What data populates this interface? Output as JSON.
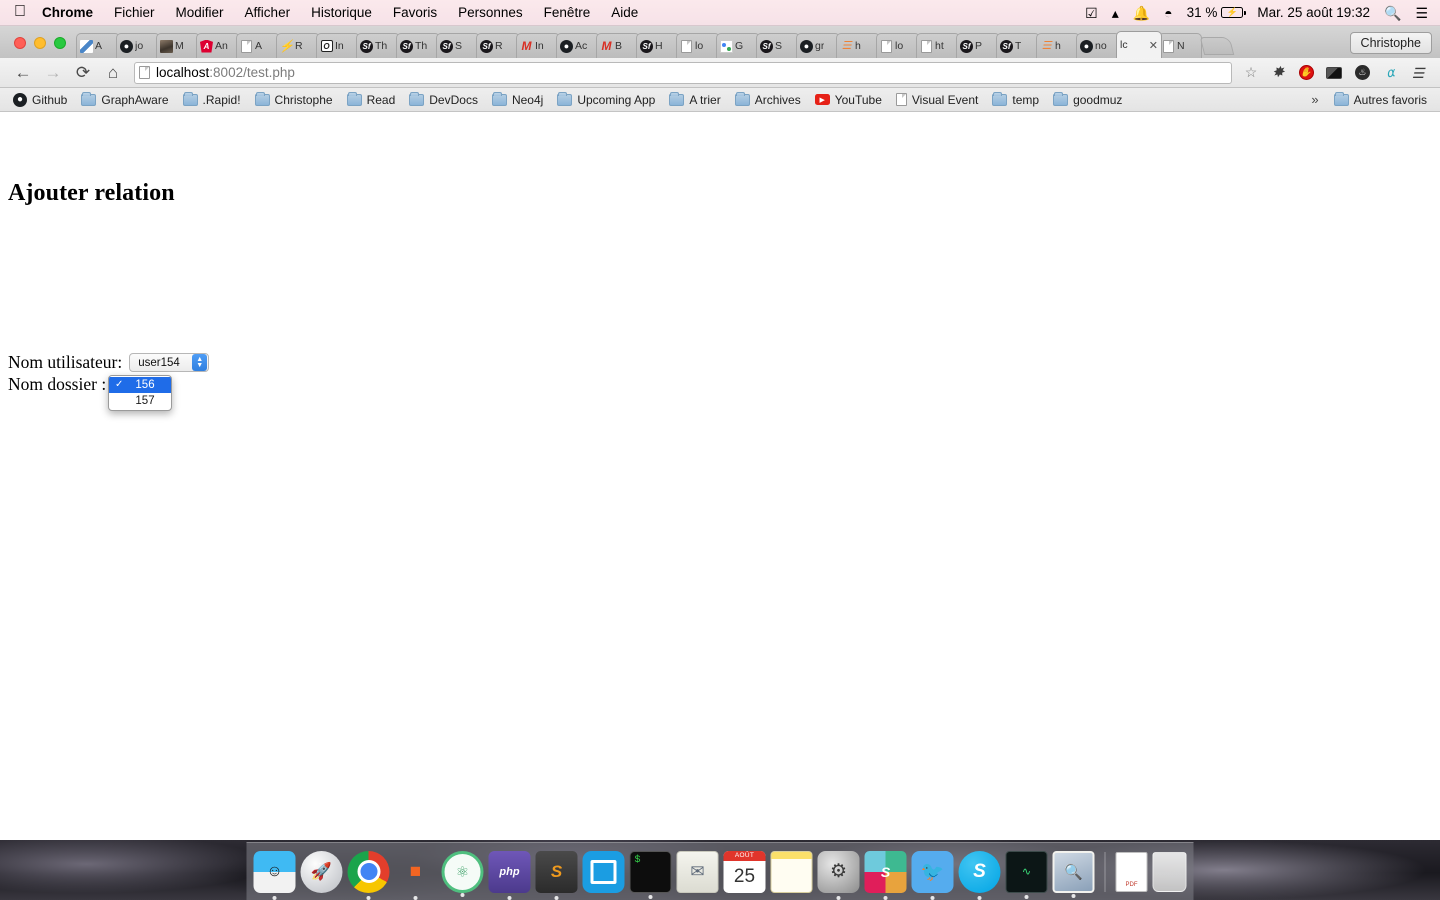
{
  "menubar": {
    "apple_icon": "apple-icon",
    "items": [
      {
        "label": "Chrome",
        "bold": true
      },
      {
        "label": "Fichier",
        "bold": false
      },
      {
        "label": "Modifier",
        "bold": false
      },
      {
        "label": "Afficher",
        "bold": false
      },
      {
        "label": "Historique",
        "bold": false
      },
      {
        "label": "Favoris",
        "bold": false
      },
      {
        "label": "Personnes",
        "bold": false
      },
      {
        "label": "Fenêtre",
        "bold": false
      },
      {
        "label": "Aide",
        "bold": false
      }
    ],
    "status": {
      "checkmark_icon": "checkmark-circle-icon",
      "drive_icon": "google-drive-icon",
      "bell_icon": "bell-icon",
      "wifi_icon": "wifi-icon",
      "battery_percent": "31 %",
      "battery_icon": "battery-charging-icon",
      "datetime": "Mar. 25 août  19:32",
      "search_icon": "spotlight-search-icon",
      "notifications_icon": "notification-center-icon"
    }
  },
  "browser": {
    "traffic_lights": [
      "close",
      "minimize",
      "zoom"
    ],
    "tabs": [
      {
        "title": "A",
        "favicon": "blue-slash-icon",
        "active": false
      },
      {
        "title": "jo",
        "favicon": "github-icon",
        "active": false
      },
      {
        "title": "M",
        "favicon": "photo-avatar-icon",
        "active": false
      },
      {
        "title": "An",
        "favicon": "angular-icon",
        "active": false
      },
      {
        "title": "A",
        "favicon": "document-icon",
        "active": false
      },
      {
        "title": "R",
        "favicon": "lightning-icon",
        "active": false
      },
      {
        "title": "In",
        "favicon": "square-o-icon",
        "active": false
      },
      {
        "title": "Th",
        "favicon": "symfony-icon",
        "active": false
      },
      {
        "title": "Th",
        "favicon": "symfony-icon",
        "active": false
      },
      {
        "title": "S",
        "favicon": "symfony-icon",
        "active": false
      },
      {
        "title": "R",
        "favicon": "symfony-icon",
        "active": false
      },
      {
        "title": "In",
        "favicon": "gmail-icon",
        "active": false
      },
      {
        "title": "Ac",
        "favicon": "github-icon",
        "active": false
      },
      {
        "title": "B",
        "favicon": "gmail-icon",
        "active": false
      },
      {
        "title": "H",
        "favicon": "symfony-icon",
        "active": false
      },
      {
        "title": "lo",
        "favicon": "document-icon",
        "active": false
      },
      {
        "title": "G",
        "favicon": "neo4j-icon",
        "active": false
      },
      {
        "title": "S",
        "favicon": "symfony-icon",
        "active": false
      },
      {
        "title": "gr",
        "favicon": "github-icon",
        "active": false
      },
      {
        "title": "h",
        "favicon": "stackoverflow-icon",
        "active": false
      },
      {
        "title": "lo",
        "favicon": "document-icon",
        "active": false
      },
      {
        "title": "ht",
        "favicon": "document-icon",
        "active": false
      },
      {
        "title": "P",
        "favicon": "symfony-icon",
        "active": false
      },
      {
        "title": "T",
        "favicon": "symfony-icon",
        "active": false
      },
      {
        "title": "h",
        "favicon": "stackoverflow-icon",
        "active": false
      },
      {
        "title": "no",
        "favicon": "github-icon",
        "active": false
      },
      {
        "title": "lc",
        "favicon": "none",
        "active": true,
        "close_label": "✕"
      },
      {
        "title": "N",
        "favicon": "document-icon",
        "active": false
      }
    ],
    "new_tab_icon": "new-tab-button",
    "profile_button": "Christophe",
    "toolbar": {
      "back_icon": "back-arrow-icon",
      "forward_icon": "forward-arrow-icon",
      "reload_icon": "reload-icon",
      "home_icon": "home-icon",
      "url_host": "localhost",
      "url_path": ":8002/test.php",
      "star_icon": "bookmark-star-icon",
      "extensions": [
        {
          "name": "gear-extension-icon",
          "glyph": "✷"
        },
        {
          "name": "adblock-extension-icon",
          "glyph": "✋"
        },
        {
          "name": "console-extension-icon",
          "glyph": ""
        },
        {
          "name": "fire-extension-icon",
          "glyph": "🔥"
        },
        {
          "name": "colorpicker-extension-icon",
          "glyph": "⚲"
        },
        {
          "name": "chrome-menu-icon",
          "glyph": "☰"
        }
      ]
    },
    "bookmarks": [
      {
        "label": "Github",
        "icon": "github-icon"
      },
      {
        "label": "GraphAware",
        "icon": "folder-icon"
      },
      {
        "label": ".Rapid!",
        "icon": "folder-icon"
      },
      {
        "label": "Christophe",
        "icon": "folder-icon"
      },
      {
        "label": "Read",
        "icon": "folder-icon"
      },
      {
        "label": "DevDocs",
        "icon": "folder-icon"
      },
      {
        "label": "Neo4j",
        "icon": "folder-icon"
      },
      {
        "label": "Upcoming App",
        "icon": "folder-icon"
      },
      {
        "label": "A trier",
        "icon": "folder-icon"
      },
      {
        "label": "Archives",
        "icon": "folder-icon"
      },
      {
        "label": "YouTube",
        "icon": "youtube-icon"
      },
      {
        "label": "Visual Event",
        "icon": "document-icon"
      },
      {
        "label": "temp",
        "icon": "folder-icon"
      },
      {
        "label": "goodmuz",
        "icon": "folder-icon"
      }
    ],
    "bookmarks_overflow": "»",
    "other_bookmarks": {
      "label": "Autres favoris",
      "icon": "folder-icon"
    }
  },
  "page": {
    "heading": "Ajouter relation",
    "user_field": {
      "label": "Nom utilisateur:",
      "selected_value": "user154",
      "stepper_icon": "up-down-chevron-icon"
    },
    "folder_field": {
      "label": "Nom dossier :",
      "open_dropdown": true,
      "options": [
        {
          "value": "156",
          "selected": true,
          "check": "✓"
        },
        {
          "value": "157",
          "selected": false,
          "check": ""
        }
      ]
    }
  },
  "dock": {
    "items": [
      {
        "name": "finder",
        "glyph": "◡",
        "running": true
      },
      {
        "name": "launchpad",
        "glyph": "🚀",
        "running": false
      },
      {
        "name": "google-chrome",
        "glyph": "",
        "running": true
      },
      {
        "name": "phpstorm",
        "glyph": "JI",
        "running": true
      },
      {
        "name": "atom",
        "glyph": "⚛",
        "running": true
      },
      {
        "name": "php",
        "glyph": "php",
        "running": true
      },
      {
        "name": "sublime-text",
        "glyph": "S",
        "running": true
      },
      {
        "name": "sequel-pro",
        "glyph": "",
        "running": false
      },
      {
        "name": "terminal",
        "glyph": "$",
        "running": true
      },
      {
        "name": "mail",
        "glyph": "✉",
        "running": false
      },
      {
        "name": "calendar",
        "glyph": "25",
        "month": "AOÛT",
        "running": false
      },
      {
        "name": "notes",
        "glyph": "",
        "running": false
      },
      {
        "name": "system-preferences",
        "glyph": "✸",
        "running": true
      },
      {
        "name": "slack",
        "glyph": "S",
        "running": true
      },
      {
        "name": "twitter",
        "glyph": "🐦",
        "running": true
      },
      {
        "name": "skype",
        "glyph": "S",
        "running": true
      },
      {
        "name": "activity-monitor",
        "glyph": "∿",
        "running": true
      },
      {
        "name": "preview",
        "glyph": "🔍",
        "running": true
      }
    ],
    "pdf_file": {
      "name": "pdf-document",
      "label": "PDF"
    },
    "trash": {
      "name": "trash"
    }
  }
}
